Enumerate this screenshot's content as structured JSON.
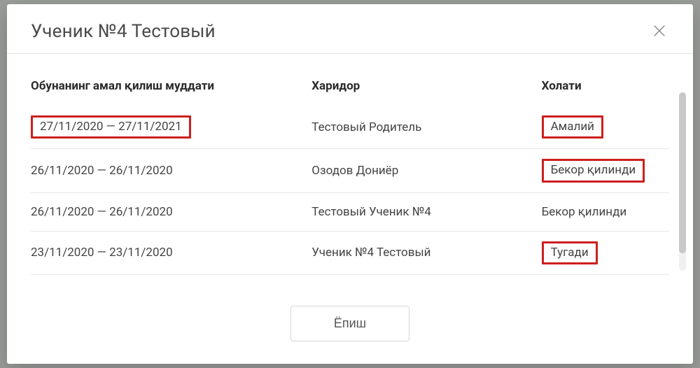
{
  "modal": {
    "title": "Ученик №4 Тестовый",
    "close_label": "close"
  },
  "table": {
    "headers": {
      "period": "Обунанинг амал қилиш муддати",
      "buyer": "Харидор",
      "status": "Холати"
    },
    "rows": [
      {
        "period": "27/11/2020 — 27/11/2021",
        "buyer": "Тестовый Родитель",
        "status": "Амалий",
        "hl_period": true,
        "hl_status": true
      },
      {
        "period": "26/11/2020 — 26/11/2020",
        "buyer": "Озодов Дониёр",
        "status": "Бекор қилинди",
        "hl_period": false,
        "hl_status": true
      },
      {
        "period": "26/11/2020 — 26/11/2020",
        "buyer": "Тестовый Ученик №4",
        "status": "Бекор қилинди",
        "hl_period": false,
        "hl_status": false
      },
      {
        "period": "23/11/2020 — 23/11/2020",
        "buyer": "Ученик №4 Тестовый",
        "status": "Тугади",
        "hl_period": false,
        "hl_status": true
      }
    ]
  },
  "footer": {
    "close_button": "Ёпиш"
  }
}
